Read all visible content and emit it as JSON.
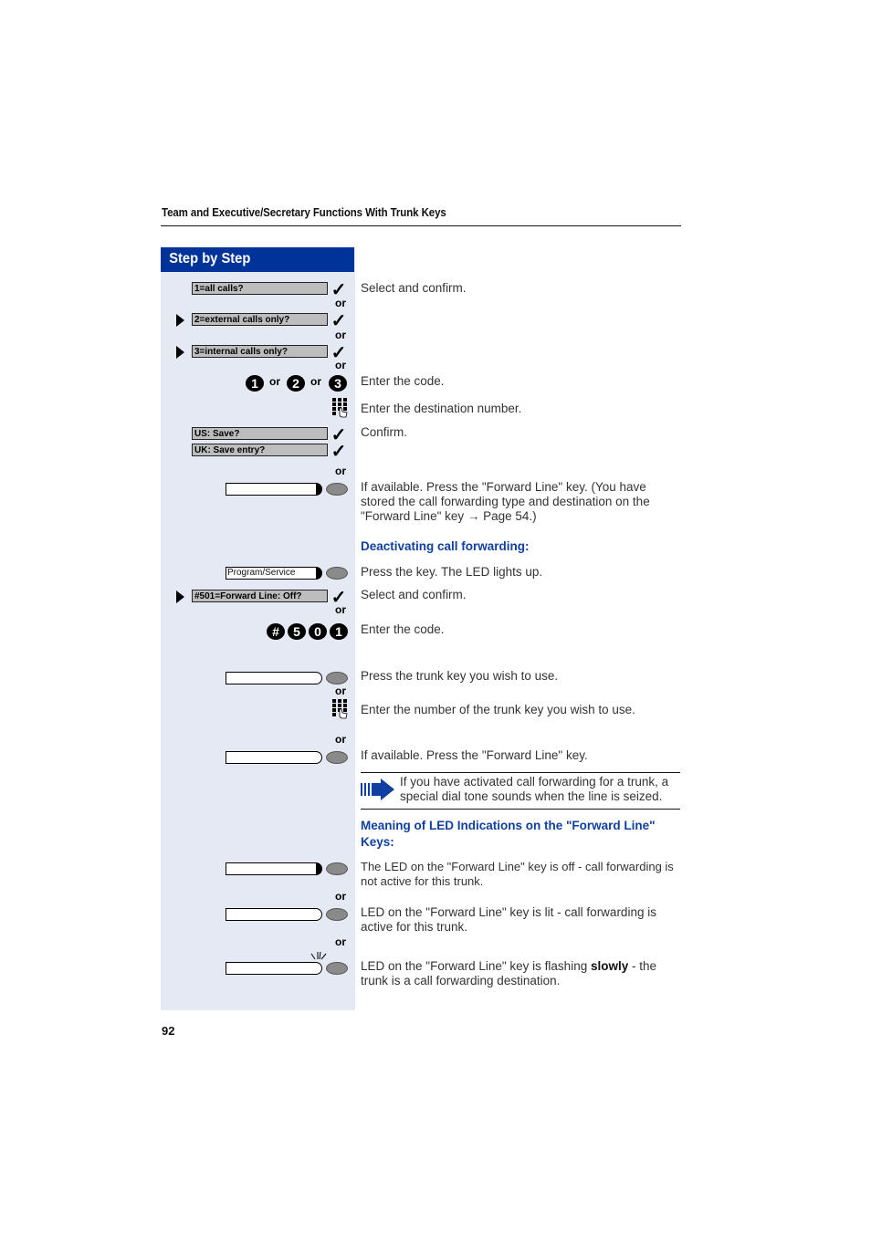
{
  "header": {
    "title": "Team and Executive/Secretary Functions With Trunk Keys"
  },
  "sidebar": {
    "title": "Step by Step"
  },
  "or_label": "or",
  "displays": {
    "all_calls": "1=all calls?",
    "external_calls": "2=external calls only?",
    "internal_calls": "3=internal calls only?",
    "us_save": "US: Save?",
    "uk_save": "UK: Save entry?",
    "forward_off": "#501=Forward Line: Off?"
  },
  "keys": {
    "program_service": "Program/Service"
  },
  "digit_keys": {
    "one": "1",
    "two": "2",
    "three": "3",
    "hash": "#",
    "five": "5",
    "zero": "0",
    "one_b": "1"
  },
  "instructions": {
    "select_confirm_1": "Select and confirm.",
    "enter_code_1": "Enter the code.",
    "enter_destination": "Enter the destination number.",
    "confirm": "Confirm.",
    "forward_line_available": "If available. Press the \"Forward Line\" key. (You have stored the call forwarding type and destination on the \"Forward Line\" key → Page 54.)",
    "deactivating_heading": "Deactivating call forwarding:",
    "press_key_led": "Press the key. The LED lights up.",
    "select_confirm_2": "Select and confirm.",
    "enter_code_2": "Enter the code.",
    "press_trunk_key": "Press the trunk key you wish to use.",
    "enter_trunk_number": "Enter the number of the trunk key you wish to use.",
    "forward_line_available_2": "If available. Press the \"Forward Line\" key.",
    "note": "If you have activated call forwarding for a trunk, a special dial tone sounds when the line is seized.",
    "led_meaning_heading": "Meaning of LED Indications on the \"Forward Line\" Keys:",
    "led_off": "The LED on the \"Forward Line\" key is off - call forwarding is not active for this trunk.",
    "led_lit": "LED on the \"Forward Line\" key is lit - call forwarding is active for this trunk.",
    "led_flash_pre": "LED on the \"Forward Line\" key is flashing ",
    "led_flash_bold": "slowly",
    "led_flash_post": " - the trunk is a call forwarding destination."
  },
  "footer": {
    "page_number": "92"
  },
  "colors": {
    "brand_blue": "#003399",
    "heading_blue": "#0f3fa0",
    "sidebar_bg": "#e5e9f4",
    "display_gray": "#bdbdbd",
    "led_gray": "#8a8a8a"
  }
}
